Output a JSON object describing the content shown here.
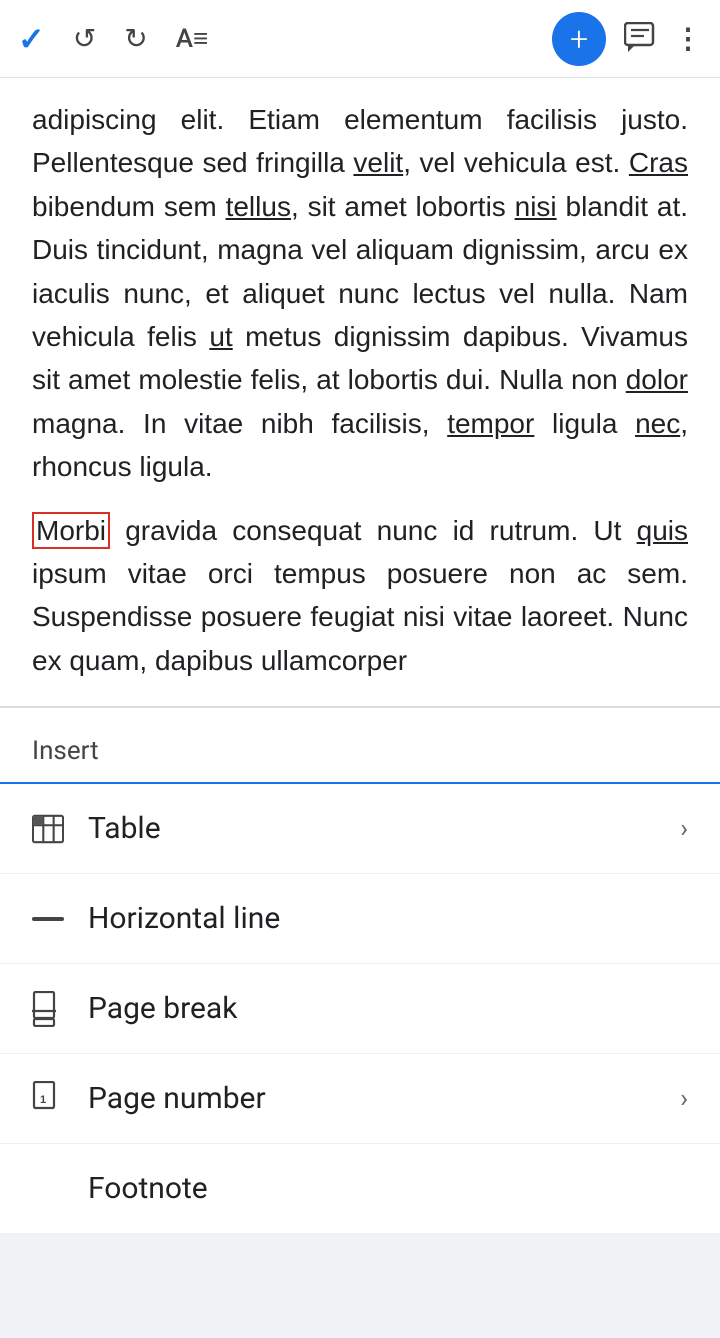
{
  "toolbar": {
    "check_label": "✓",
    "undo_label": "↺",
    "redo_label": "↻",
    "text_format_label": "A≡",
    "plus_label": "+",
    "comment_label": "💬",
    "more_label": "⋮"
  },
  "document": {
    "partial_text": "adipiscing elit. Etiam elementum facilisis justo. Pellentesque sed fringilla velit, vel vehicula est. Cras bibendum sem tellus, sit amet lobortis nisi blandit at. Duis tincidunt, magna vel aliquam dignissim, arcu ex iaculis nunc, et aliquet nunc lectus vel nulla. Nam vehicula felis ut metus dignissim dapibus. Vivamus sit amet molestie felis, at lobortis dui. Nulla non dolor magna. In vitae nibh facilisis, tempor ligula nec, rhoncus ligula.",
    "cursor_paragraph": "Morbi gravida consequat nunc id rutrum. Ut quis ipsum vitae orci tempus posuere non ac sem. Suspendisse posuere feugiat nisi vitae laoreet. Nunc ex quam, dapibus ullamcorper"
  },
  "insert_menu": {
    "header": "Insert",
    "items": [
      {
        "id": "table",
        "label": "Table",
        "has_chevron": true
      },
      {
        "id": "horizontal-line",
        "label": "Horizontal line",
        "has_chevron": false
      },
      {
        "id": "page-break",
        "label": "Page break",
        "has_chevron": false
      },
      {
        "id": "page-number",
        "label": "Page number",
        "has_chevron": true
      },
      {
        "id": "footnote",
        "label": "Footnote",
        "has_chevron": false
      }
    ]
  }
}
